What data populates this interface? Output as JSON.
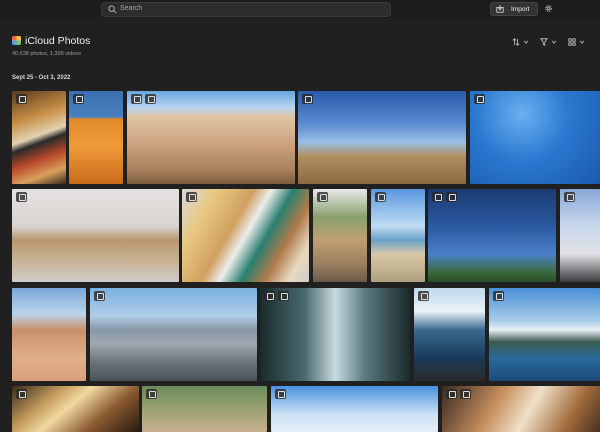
{
  "search": {
    "placeholder": "Search"
  },
  "toolbar": {
    "import_label": "Import"
  },
  "header": {
    "title": "iCloud Photos",
    "counts": "40,638 photos, 1,399 videos"
  },
  "section": {
    "date": "Sept 25 - Oct 3, 2022"
  },
  "icons": [
    "search-icon",
    "import-icon",
    "gear-icon",
    "sort-icon",
    "filter-icon",
    "view-size-icon",
    "chevron-down-icon"
  ]
}
